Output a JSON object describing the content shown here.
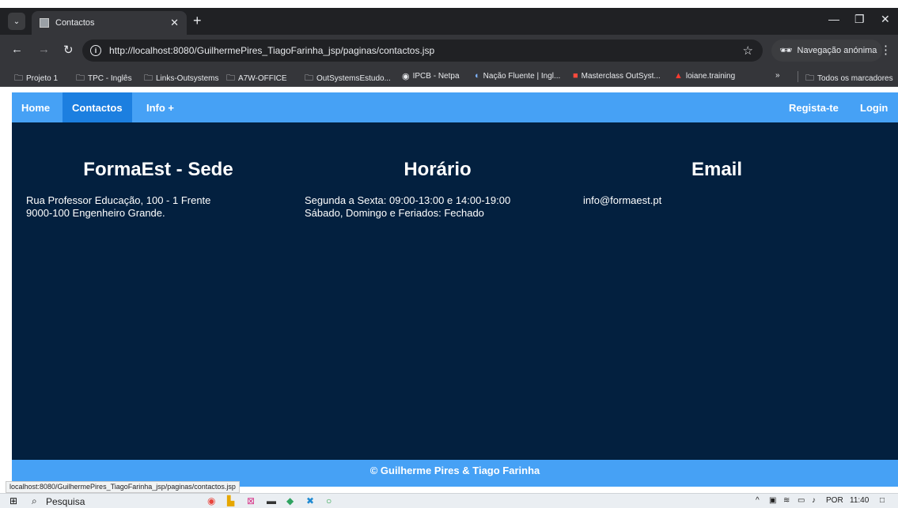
{
  "browser": {
    "tab_title": "Contactos",
    "url": "http://localhost:8080/GuilhermePires_TiagoFarinha_jsp/paginas/contactos.jsp",
    "incognito_label": "Navegação anónima",
    "bookmarks": [
      "Projeto 1",
      "TPC - Inglês",
      "Links-Outsystems",
      "A7W-OFFICE",
      "OutSystemsEstudo...",
      "IPCB - Netpa",
      "Nação Fluente | Ingl...",
      "Masterclass OutSyst...",
      "loiane.training"
    ],
    "all_bookmarks": "Todos os marcadores",
    "status_url": "localhost:8080/GuilhermePires_TiagoFarinha_jsp/paginas/contactos.jsp"
  },
  "nav": {
    "home": "Home",
    "contactos": "Contactos",
    "info": "Info +",
    "register": "Regista-te",
    "login": "Login"
  },
  "columns": [
    {
      "title": "FormaEst - Sede",
      "lines": [
        "Rua Professor Educação, 100 - 1 Frente",
        "9000-100 Engenheiro Grande."
      ]
    },
    {
      "title": "Horário",
      "lines": [
        "Segunda a Sexta: 09:00-13:00 e 14:00-19:00",
        "Sábado, Domingo e Feriados: Fechado"
      ]
    },
    {
      "title": "Email",
      "lines": [
        "info@formaest.pt"
      ]
    }
  ],
  "footer": "© Guilherme Pires & Tiago Farinha",
  "taskbar": {
    "search": "Pesquisa",
    "lang": "POR",
    "time": "11:40"
  },
  "colors": {
    "navbar": "#46a1f5",
    "active_nav": "#1c7fe0",
    "page_bg": "#03203f"
  }
}
